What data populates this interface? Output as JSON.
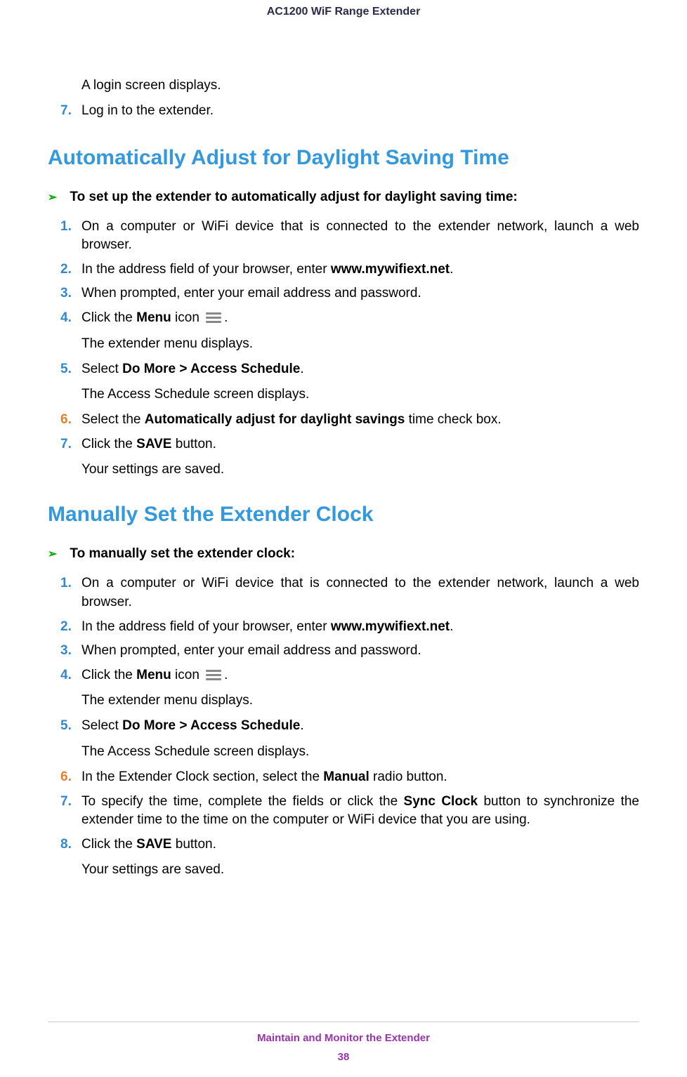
{
  "header": {
    "title": "AC1200 WiF Range Extender"
  },
  "intro": {
    "text": "A login screen displays.",
    "step7_num": "7.",
    "step7_text": "Log in to the extender."
  },
  "section1": {
    "heading": "Automatically Adjust for Daylight Saving Time",
    "task": "To set up the extender to automatically adjust for daylight saving time:",
    "steps": {
      "s1_num": "1.",
      "s1_text": "On a computer or WiFi device that is connected to the extender network, launch a web browser.",
      "s2_num": "2.",
      "s2_pre": "In the address field of your browser, enter ",
      "s2_bold": "www.mywifiext.net",
      "s2_post": ".",
      "s3_num": "3.",
      "s3_text": "When prompted, enter your email address and password.",
      "s4_num": "4.",
      "s4_pre": "Click the ",
      "s4_bold": "Menu",
      "s4_mid": " icon ",
      "s4_post": ".",
      "s4_sub": "The extender menu displays.",
      "s5_num": "5.",
      "s5_pre": "Select ",
      "s5_bold": "Do More > Access Schedule",
      "s5_post": ".",
      "s5_sub": "The Access Schedule screen displays.",
      "s6_num": "6.",
      "s6_pre": "Select the ",
      "s6_bold": "Automatically adjust for daylight savings",
      "s6_post": " time check box.",
      "s7_num": "7.",
      "s7_pre": "Click the ",
      "s7_bold": "SAVE",
      "s7_post": " button.",
      "s7_sub": "Your settings are saved."
    }
  },
  "section2": {
    "heading": "Manually Set the Extender Clock",
    "task": "To manually set the extender clock:",
    "steps": {
      "s1_num": "1.",
      "s1_text": "On a computer or WiFi device that is connected to the extender network, launch a web browser.",
      "s2_num": "2.",
      "s2_pre": "In the address field of your browser, enter ",
      "s2_bold": "www.mywifiext.net",
      "s2_post": ".",
      "s3_num": "3.",
      "s3_text": "When prompted, enter your email address and password.",
      "s4_num": "4.",
      "s4_pre": "Click the ",
      "s4_bold": "Menu",
      "s4_mid": " icon ",
      "s4_post": ".",
      "s4_sub": "The extender menu displays.",
      "s5_num": "5.",
      "s5_pre": "Select ",
      "s5_bold": "Do More > Access Schedule",
      "s5_post": ".",
      "s5_sub": "The Access Schedule screen displays.",
      "s6_num": "6.",
      "s6_pre": "In the Extender Clock section, select the ",
      "s6_bold": "Manual",
      "s6_post": " radio button.",
      "s7_num": "7.",
      "s7_pre": "To specify the time, complete the fields or click the ",
      "s7_bold": "Sync Clock",
      "s7_post": " button to synchronize the extender time to the time on the computer or WiFi device that you are using.",
      "s8_num": "8.",
      "s8_pre": "Click the ",
      "s8_bold": "SAVE",
      "s8_post": " button.",
      "s8_sub": "Your settings are saved."
    }
  },
  "footer": {
    "title": "Maintain and Monitor the Extender",
    "page": "38"
  },
  "arrow": "➢"
}
